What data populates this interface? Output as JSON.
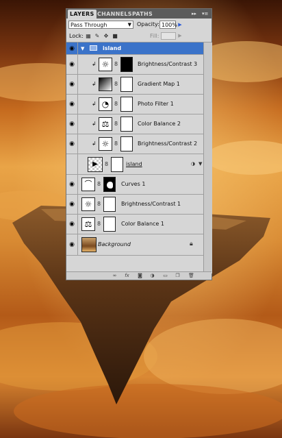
{
  "panel": {
    "tabs": [
      "LAYERS",
      "CHANNELS",
      "PATHS"
    ],
    "tab_controls": [
      "▸▸",
      "▾≡"
    ],
    "blend_mode": "Pass Through",
    "opacity_label": "Opacity:",
    "opacity_value": "100%",
    "lock_label": "Lock:",
    "fill_label": "Fill:",
    "fill_value": ""
  },
  "layers": [
    {
      "name": "island",
      "kind": "group",
      "visible": true,
      "selected": true
    },
    {
      "name": "Brightness/Contrast 3",
      "kind": "adjustment",
      "icon": "brightness-contrast",
      "clipped": true,
      "visible": true
    },
    {
      "name": "Gradient Map 1",
      "kind": "adjustment",
      "icon": "gradient-map",
      "clipped": true,
      "visible": true
    },
    {
      "name": "Photo Filter 1",
      "kind": "adjustment",
      "icon": "photo-filter",
      "clipped": true,
      "visible": true
    },
    {
      "name": "Color Balance 2",
      "kind": "adjustment",
      "icon": "color-balance",
      "clipped": true,
      "visible": true
    },
    {
      "name": "Brightness/Contrast 2",
      "kind": "adjustment",
      "icon": "brightness-contrast",
      "clipped": true,
      "visible": true
    },
    {
      "name": "island",
      "kind": "smart-object",
      "visible": false
    },
    {
      "name": "Curves 1",
      "kind": "adjustment",
      "icon": "curves",
      "visible": true
    },
    {
      "name": "Brightness/Contrast 1",
      "kind": "adjustment",
      "icon": "brightness-contrast",
      "visible": true
    },
    {
      "name": "Color Balance 1",
      "kind": "adjustment",
      "icon": "color-balance",
      "visible": true
    },
    {
      "name": "Background",
      "kind": "background",
      "locked": true,
      "visible": true
    }
  ],
  "footer_icons": [
    "link-layers-icon",
    "fx-icon",
    "add-mask-icon",
    "new-adjustment-icon",
    "new-group-icon",
    "new-layer-icon",
    "delete-layer-icon"
  ],
  "colors": {
    "selection": "#3b73c9",
    "panel": "#d6d6d6",
    "tabbar": "#5b5b5b"
  }
}
